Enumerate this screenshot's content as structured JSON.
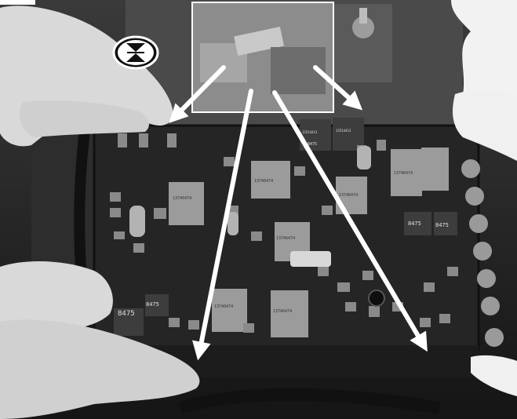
{
  "image": {
    "style": "grayscale photograph",
    "icons": [
      "press-tabs-icon",
      "arrow-icon"
    ]
  },
  "labels": {
    "relay_a": "13746474",
    "relay_b": "13746474",
    "relay_c": "13746474",
    "relay_d": "13746474",
    "relay_e": "13746474",
    "relay_f": "13746474",
    "relay_g": "13746474",
    "small_1": "8475",
    "small_2": "8475",
    "small_3": "8475",
    "small_4": "8475",
    "small_5": "8475",
    "top_1": "13514413",
    "top_2": "13514413"
  }
}
